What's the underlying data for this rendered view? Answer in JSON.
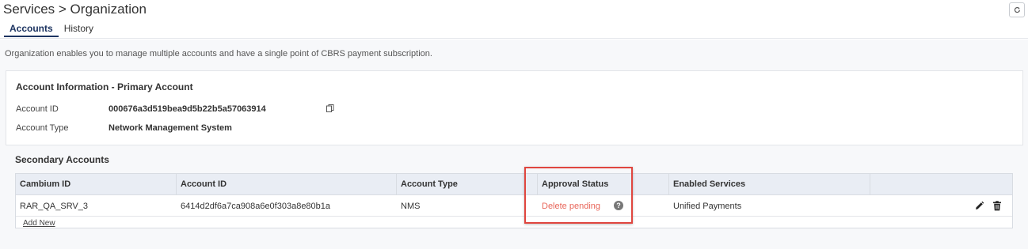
{
  "header": {
    "breadcrumb": "Services > Organization",
    "tabs": [
      {
        "label": "Accounts",
        "active": true
      },
      {
        "label": "History",
        "active": false
      }
    ],
    "refresh_icon": "refresh-icon"
  },
  "description": "Organization enables you to manage multiple accounts and have a single point of CBRS payment subscription.",
  "primary_account": {
    "title": "Account Information - Primary Account",
    "account_id_label": "Account ID",
    "account_id_value": "000676a3d519bea9d5b22b5a57063914",
    "account_type_label": "Account Type",
    "account_type_value": "Network Management System",
    "copy_icon": "copy-icon"
  },
  "secondary_accounts": {
    "title": "Secondary Accounts",
    "columns": [
      "Cambium ID",
      "Account ID",
      "Account Type",
      "Approval Status",
      "Enabled Services",
      ""
    ],
    "rows": [
      {
        "cambium_id": "RAR_QA_SRV_3",
        "account_id": "6414d2df6a7ca908a6e0f303a8e80b1a",
        "account_type": "NMS",
        "approval_status": "Delete pending",
        "enabled_services": "Unified Payments"
      }
    ],
    "add_new_label": "Add New"
  },
  "colors": {
    "accent": "#1d3461",
    "status_pending": "#e8665a",
    "highlight": "#e0463f",
    "header_bg": "#e9edf4"
  }
}
